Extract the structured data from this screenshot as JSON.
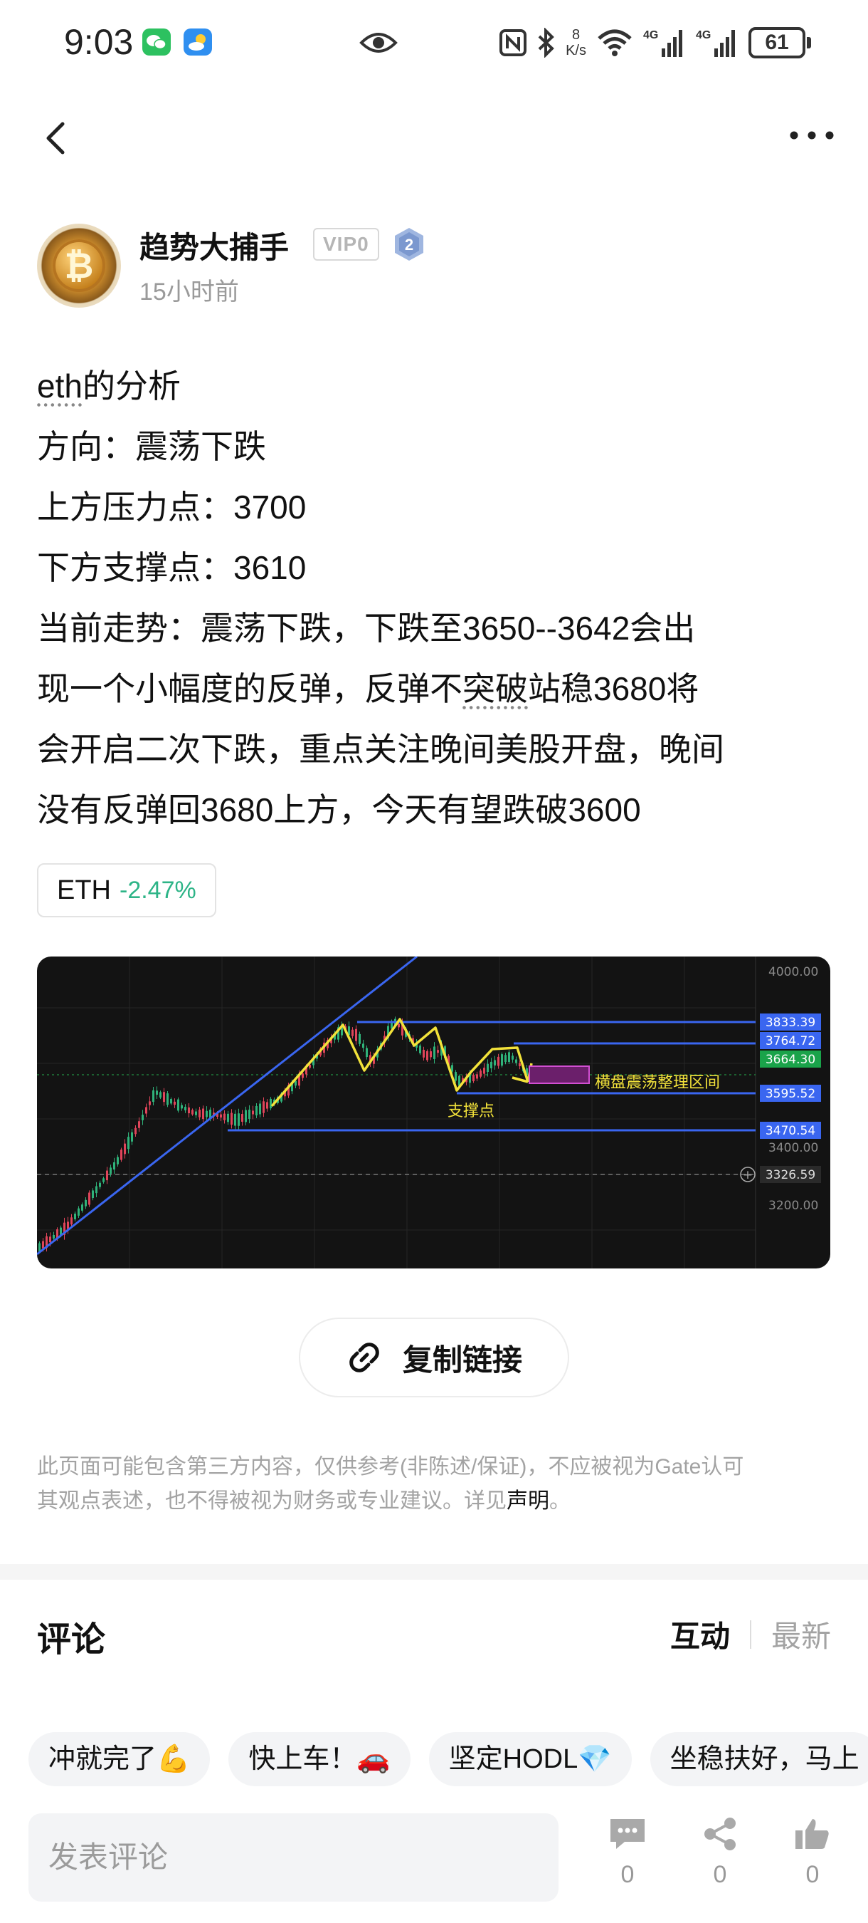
{
  "status_bar": {
    "time": "9:03",
    "net_speed_value": "8",
    "net_speed_unit": "K/s",
    "battery": "61",
    "icons": [
      "wechat-icon",
      "weather-icon",
      "eye-icon",
      "nfc-icon",
      "bluetooth-icon",
      "wifi-icon",
      "signal-4g-icon",
      "signal-4g-icon",
      "battery-icon"
    ]
  },
  "nav": {
    "back_icon": "chevron-left-icon",
    "more_icon": "more-dots-icon"
  },
  "author": {
    "name": "趋势大捕手",
    "vip": "VIP0",
    "level": "2",
    "time_ago": "15小时前"
  },
  "post": {
    "title_prefix": "eth",
    "title_suffix": "的分析",
    "lines": [
      "方向：震荡下跌",
      "上方压力点：3700",
      "下方支撑点：3610",
      "当前走势：震荡下跌，下跌至3650--3642会出",
      "会开启二次下跌，重点关注晚间美股开盘，晚间",
      "没有反弹回3680上方，今天有望跌破3600"
    ],
    "line6_a": "现一个小幅度的反弹，反弹不",
    "line6_b": "突破",
    "line6_c": "站稳3680将"
  },
  "ticker": {
    "symbol": "ETH",
    "change": "-2.47%",
    "change_color": "#2db487"
  },
  "chart": {
    "axis_labels": [
      "4000.00",
      "3400.00",
      "3200.00"
    ],
    "price_tags": [
      {
        "value": "3833.39",
        "color": "#3a66f0"
      },
      {
        "value": "3764.72",
        "color": "#3a66f0"
      },
      {
        "value": "3664.30",
        "color": "#1aa34a"
      },
      {
        "value": "3595.52",
        "color": "#3a66f0"
      },
      {
        "value": "3470.54",
        "color": "#3a66f0"
      },
      {
        "value": "3326.59",
        "color": "#2a2a2a"
      }
    ],
    "annotation_range": "横盘震荡整理区间",
    "annotation_support": "支撑点"
  },
  "copy_link": {
    "label": "复制链接",
    "icon": "link-icon"
  },
  "disclaimer": {
    "text_1": "此页面可能包含第三方内容，仅供参考(非陈述/保证)，不应被视为Gate认可",
    "text_2": "其观点表述，也不得被视为财务或专业建议。详见",
    "link": "声明",
    "end": "。"
  },
  "comments": {
    "title": "评论",
    "sort_active": "互动",
    "sort_inactive": "最新",
    "quick_replies": [
      "冲就完了💪",
      "快上车！🚗",
      "坚定HODL💎",
      "坐稳扶好，马上"
    ],
    "input_placeholder": "发表评论",
    "actions": [
      {
        "icon": "comment-icon",
        "count": "0"
      },
      {
        "icon": "share-icon",
        "count": "0"
      },
      {
        "icon": "like-icon",
        "count": "0"
      }
    ]
  }
}
